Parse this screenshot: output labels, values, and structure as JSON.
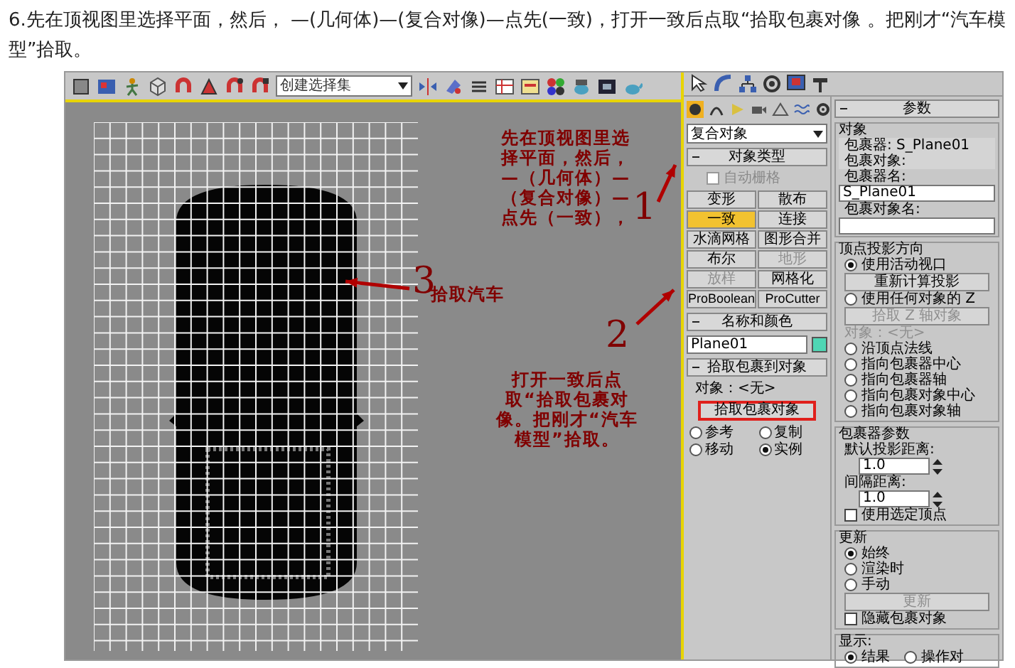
{
  "caption": "6.先在顶视图里选择平面，然后， —(几何体)—(复合对像)—点先(一致)，打开一致后点取“拾取包裹对像 。把刚才“汽车模型”拾取。",
  "toolbar": {
    "selection_set": "创建选择集"
  },
  "annotations": [
    {
      "number": "1",
      "text": "先在顶视图里选择平面，然后，—（几何体）—（复合对像）—点先（一致），"
    },
    {
      "number": "2",
      "text": "打开一致后点取“拾取包裹对像。把刚才“汽车模型”拾取。"
    },
    {
      "number": "3",
      "text": "拾取汽车"
    }
  ],
  "create_panel": {
    "category": "复合对象",
    "object_type": {
      "title": "对象类型",
      "autogrid": {
        "label": "自动栅格",
        "checked": false,
        "disabled": true
      },
      "buttons": [
        {
          "label": "变形",
          "selected": false,
          "disabled": false
        },
        {
          "label": "散布",
          "selected": false,
          "disabled": false
        },
        {
          "label": "一致",
          "selected": true,
          "disabled": false
        },
        {
          "label": "连接",
          "selected": false,
          "disabled": false
        },
        {
          "label": "水滴网格",
          "selected": false,
          "disabled": false
        },
        {
          "label": "图形合并",
          "selected": false,
          "disabled": false
        },
        {
          "label": "布尔",
          "selected": false,
          "disabled": false
        },
        {
          "label": "地形",
          "selected": false,
          "disabled": true
        },
        {
          "label": "放样",
          "selected": false,
          "disabled": true
        },
        {
          "label": "网格化",
          "selected": false,
          "disabled": false
        },
        {
          "label": "ProBoolean",
          "selected": false,
          "disabled": false
        },
        {
          "label": "ProCutter",
          "selected": false,
          "disabled": false
        }
      ]
    },
    "name_and_color": {
      "title": "名称和颜色",
      "name": "Plane01",
      "color": "#4fd6b4"
    },
    "pick": {
      "title": "拾取包裹到对象",
      "object": "对象：<无>",
      "button": "拾取包裹对象",
      "modes": [
        {
          "label": "参考",
          "selected": false
        },
        {
          "label": "复制",
          "selected": false
        },
        {
          "label": "移动",
          "selected": false
        },
        {
          "label": "实例",
          "selected": true
        }
      ]
    }
  },
  "parameters": {
    "title": "参数",
    "groups": [
      {
        "title": "对象",
        "rows": [
          {
            "kind": "info",
            "text": "包裹器: S_Plane01",
            "disabled": false
          },
          {
            "kind": "info",
            "text": "包裹对象:",
            "disabled": false
          },
          {
            "kind": "label",
            "text": "包裹器名:",
            "disabled": false
          },
          {
            "kind": "field",
            "value": "S_Plane01",
            "disabled": false
          },
          {
            "kind": "label",
            "text": "包裹对象名:",
            "disabled": false
          },
          {
            "kind": "field",
            "disabled": false
          }
        ]
      },
      {
        "title": "顶点投影方向",
        "rows": [
          {
            "kind": "radio",
            "text": "使用活动视口",
            "selected": true,
            "disabled": false
          },
          {
            "kind": "button",
            "text": "重新计算投影",
            "disabled": false
          },
          {
            "kind": "radio",
            "text": "使用任何对象的 Z",
            "selected": false,
            "disabled": false
          },
          {
            "kind": "button",
            "text": "拾取 Z 轴对象",
            "disabled": true
          },
          {
            "kind": "label",
            "text": "对象：<无>",
            "disabled": true
          },
          {
            "kind": "radio",
            "text": "沿顶点法线",
            "selected": false,
            "disabled": false
          },
          {
            "kind": "radio",
            "text": "指向包裹器中心",
            "selected": false,
            "disabled": false
          },
          {
            "kind": "radio",
            "text": "指向包裹器轴",
            "selected": false,
            "disabled": false
          },
          {
            "kind": "radio",
            "text": "指向包裹对象中心",
            "selected": false,
            "disabled": false
          },
          {
            "kind": "radio",
            "text": "指向包裹对象轴",
            "selected": false,
            "disabled": false
          }
        ]
      },
      {
        "title": "包裹器参数",
        "rows": [
          {
            "kind": "label",
            "text": "默认投影距离:",
            "disabled": false
          },
          {
            "kind": "spinner",
            "value": "1.0",
            "disabled": false
          },
          {
            "kind": "label",
            "text": "间隔距离:",
            "disabled": false
          },
          {
            "kind": "spinner",
            "value": "1.0",
            "disabled": false
          },
          {
            "kind": "checkbox",
            "text": "使用选定顶点",
            "checked": false,
            "disabled": false
          }
        ]
      },
      {
        "title": "更新",
        "rows": [
          {
            "kind": "radio",
            "text": "始终",
            "selected": true,
            "disabled": false
          },
          {
            "kind": "radio",
            "text": "渲染时",
            "selected": false,
            "disabled": false
          },
          {
            "kind": "radio",
            "text": "手动",
            "selected": false,
            "disabled": false
          },
          {
            "kind": "button",
            "text": "更新",
            "disabled": true
          },
          {
            "kind": "checkbox",
            "text": "隐藏包裹对象",
            "checked": false,
            "disabled": false
          }
        ]
      },
      {
        "title": "显示:",
        "rows": [
          {
            "kind": "radio_row",
            "disabled": false,
            "options": [
              {
                "text": "结果",
                "selected": true
              },
              {
                "text": "操作对",
                "selected": false
              }
            ]
          }
        ]
      }
    ]
  }
}
